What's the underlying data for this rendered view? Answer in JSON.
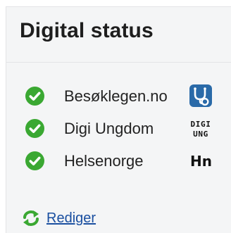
{
  "panel": {
    "title": "Digital status"
  },
  "services": [
    {
      "label": "Besøklegen.no",
      "status_icon": "check-circle-icon",
      "logo_icon": "stethoscope-logo-icon"
    },
    {
      "label": "Digi Ungdom",
      "status_icon": "check-circle-icon",
      "logo_icon": "digi-ungdom-logo-icon",
      "logo_text_top": "DIGI",
      "logo_text_bottom": "UNG"
    },
    {
      "label": "Helsenorge",
      "status_icon": "check-circle-icon",
      "logo_icon": "helsenorge-logo-icon",
      "logo_text": "Hn"
    }
  ],
  "actions": {
    "edit_label": "Rediger",
    "edit_icon": "refresh-icon"
  },
  "colors": {
    "status_ok": "#3aa832",
    "link": "#1a4fa0",
    "logo_blue": "#2a6aa8",
    "panel_bg": "#f4f5f6"
  }
}
